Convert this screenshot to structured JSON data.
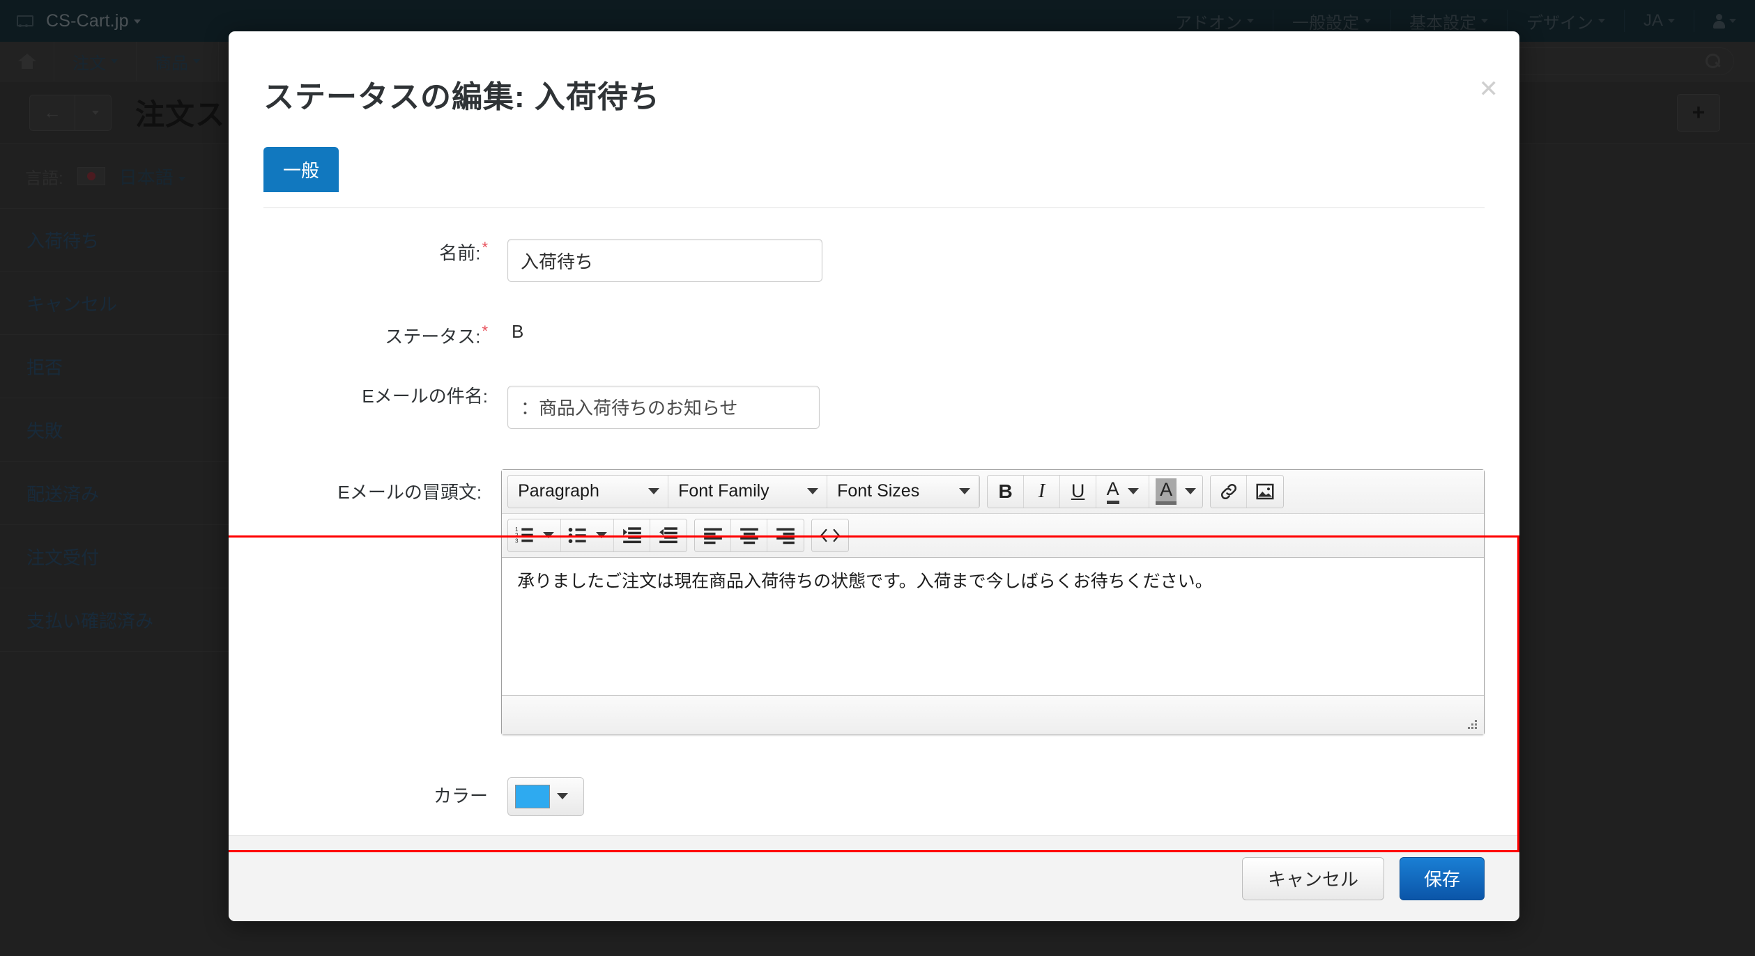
{
  "topbar": {
    "logo_icon": "cart-icon",
    "brand": "CS-Cart.jp",
    "menu": [
      {
        "label": "アドオン",
        "icon": "chevron-down-icon"
      },
      {
        "label": "一般設定",
        "icon": "chevron-down-icon"
      },
      {
        "label": "基本設定",
        "icon": "chevron-down-icon"
      },
      {
        "label": "デザイン",
        "icon": "chevron-down-icon"
      },
      {
        "label": "JA",
        "icon": "chevron-down-icon"
      }
    ],
    "account_icon": "user-icon"
  },
  "navbar": {
    "home_icon": "home-icon",
    "items": [
      {
        "label": "注文"
      },
      {
        "label": "商品"
      }
    ],
    "search_icon": "search-icon",
    "search_value": ""
  },
  "pageheader": {
    "back_icon": "back-arrow-icon",
    "back_caret_icon": "chevron-down-icon",
    "title": "注文ス",
    "add_icon": "plus-icon"
  },
  "language": {
    "label": "言語:",
    "flag_icon": "japan-flag-icon",
    "value": "日本語",
    "caret_icon": "chevron-down-icon"
  },
  "status_list": [
    {
      "label": "入荷待ち"
    },
    {
      "label": "キャンセル"
    },
    {
      "label": "拒否"
    },
    {
      "label": "失敗"
    },
    {
      "label": "配送済み"
    },
    {
      "label": "注文受付"
    },
    {
      "label": "支払い確認済み"
    }
  ],
  "modal": {
    "title": "ステータスの編集: 入荷待ち",
    "close_icon": "close-icon",
    "tabs": [
      {
        "label": "一般",
        "active": true
      }
    ],
    "fields": {
      "name": {
        "label": "名前:",
        "required_mark": "*",
        "value": "入荷待ち",
        "placeholder": ""
      },
      "status": {
        "label": "ステータス:",
        "required_mark": "*",
        "value": "B"
      },
      "subject": {
        "label": "Eメールの件名:",
        "value": "：商品入荷待ちのお知らせ",
        "placeholder": ""
      },
      "body": {
        "label": "Eメールの冒頭文:",
        "content": "承りましたご注文は現在商品入荷待ちの状態です。入荷まで今しばらくお待ちください。"
      },
      "color": {
        "label": "カラー",
        "value": "#2eaaf0",
        "caret_icon": "chevron-down-icon"
      }
    },
    "editor_toolbar": {
      "row1": [
        {
          "name": "format-select",
          "label": "Paragraph",
          "icon": "chevron-down-icon",
          "type": "select"
        },
        {
          "name": "font-family-select",
          "label": "Font Family",
          "icon": "chevron-down-icon",
          "type": "select"
        },
        {
          "name": "font-size-select",
          "label": "Font Sizes",
          "icon": "chevron-down-icon",
          "type": "select"
        },
        {
          "name": "bold-button",
          "label": "B",
          "icon": "bold-icon",
          "type": "button"
        },
        {
          "name": "italic-button",
          "label": "I",
          "icon": "italic-icon",
          "type": "button"
        },
        {
          "name": "underline-button",
          "label": "U",
          "icon": "underline-icon",
          "type": "button"
        },
        {
          "name": "text-color-button",
          "label": "A",
          "icon": "text-color-icon",
          "type": "split"
        },
        {
          "name": "background-color-button",
          "label": "A",
          "icon": "highlight-color-icon",
          "type": "split"
        },
        {
          "name": "insert-link-button",
          "label": "",
          "icon": "link-icon",
          "type": "button"
        },
        {
          "name": "insert-image-button",
          "label": "",
          "icon": "image-icon",
          "type": "button"
        }
      ],
      "row2": [
        {
          "name": "numbered-list-button",
          "icon": "numbered-list-icon",
          "type": "split"
        },
        {
          "name": "bullet-list-button",
          "icon": "bullet-list-icon",
          "type": "split"
        },
        {
          "name": "increase-indent-button",
          "icon": "indent-increase-icon",
          "type": "button"
        },
        {
          "name": "decrease-indent-button",
          "icon": "indent-decrease-icon",
          "type": "button"
        },
        {
          "name": "align-left-button",
          "icon": "align-left-icon",
          "type": "button"
        },
        {
          "name": "align-center-button",
          "icon": "align-center-icon",
          "type": "button"
        },
        {
          "name": "align-right-button",
          "icon": "align-right-icon",
          "type": "button"
        },
        {
          "name": "source-code-button",
          "icon": "source-code-icon",
          "type": "button"
        }
      ],
      "resize_icon": "resize-grip-icon"
    },
    "footer": {
      "cancel_label": "キャンセル",
      "save_label": "保存"
    }
  },
  "colors": {
    "topbar_bg": "#05222e",
    "tab_active": "#1178bf",
    "save_button": "#0b55a8",
    "required_mark": "#e8505b",
    "highlight_border": "#ff0000",
    "status_color_swatch": "#2eaaf0"
  }
}
